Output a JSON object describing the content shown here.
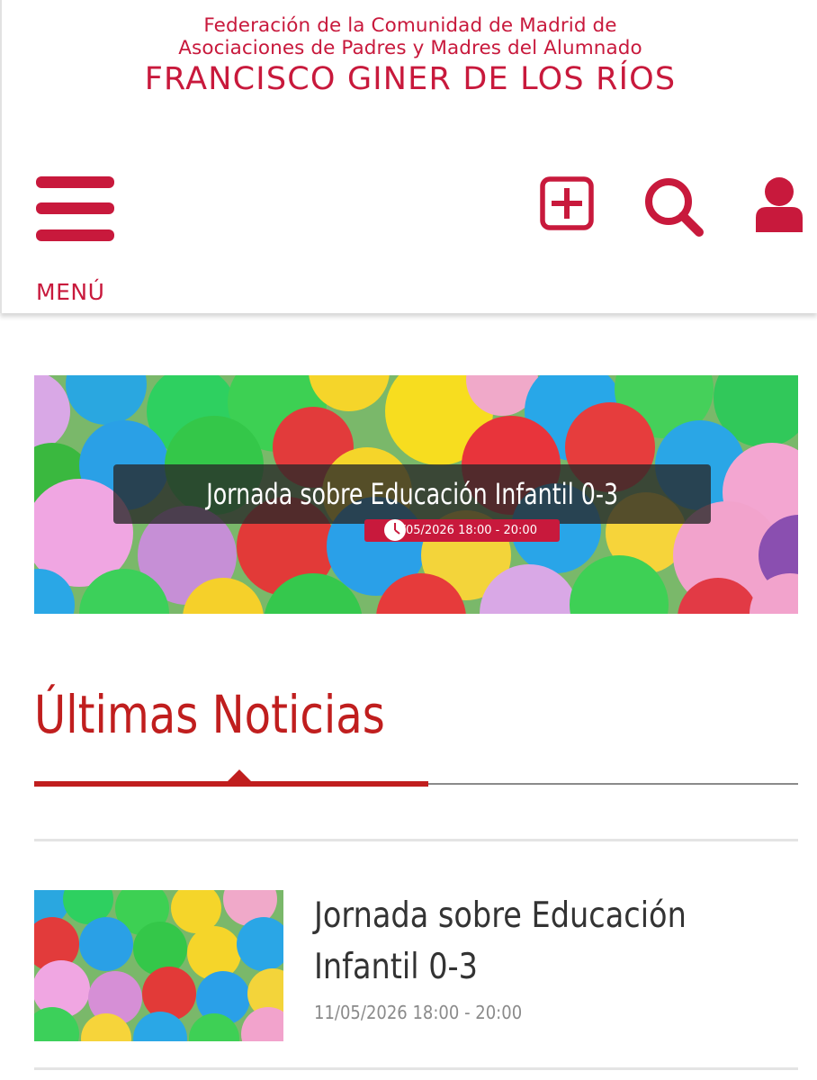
{
  "header": {
    "org_line_1": "Federación de la Comunidad de Madrid de",
    "org_line_2": "Asociaciones de Padres y Madres del Alumnado",
    "org_name": "FRANCISCO GINER DE LOS RÍOS",
    "menu_label": "MENÚ",
    "icons": [
      "menu-icon",
      "add-square-icon",
      "search-icon",
      "user-icon"
    ]
  },
  "hero": {
    "title": "Jornada sobre Educación Infantil 0-3",
    "date": "11/05/2026 18:00 - 20:00",
    "image": "colorful-ball-pit"
  },
  "section": {
    "title": "Últimas Noticias"
  },
  "news": [
    {
      "title_line_1": "Jornada sobre Educación",
      "title_line_2": "Infantil 0-3",
      "date": "11/05/2026 18:00 - 20:00",
      "image": "colorful-ball-pit"
    }
  ],
  "colors": {
    "brand": "#c8193c",
    "section_title": "#c01e1e",
    "text": "#333333",
    "muted": "#8a8a8a"
  }
}
